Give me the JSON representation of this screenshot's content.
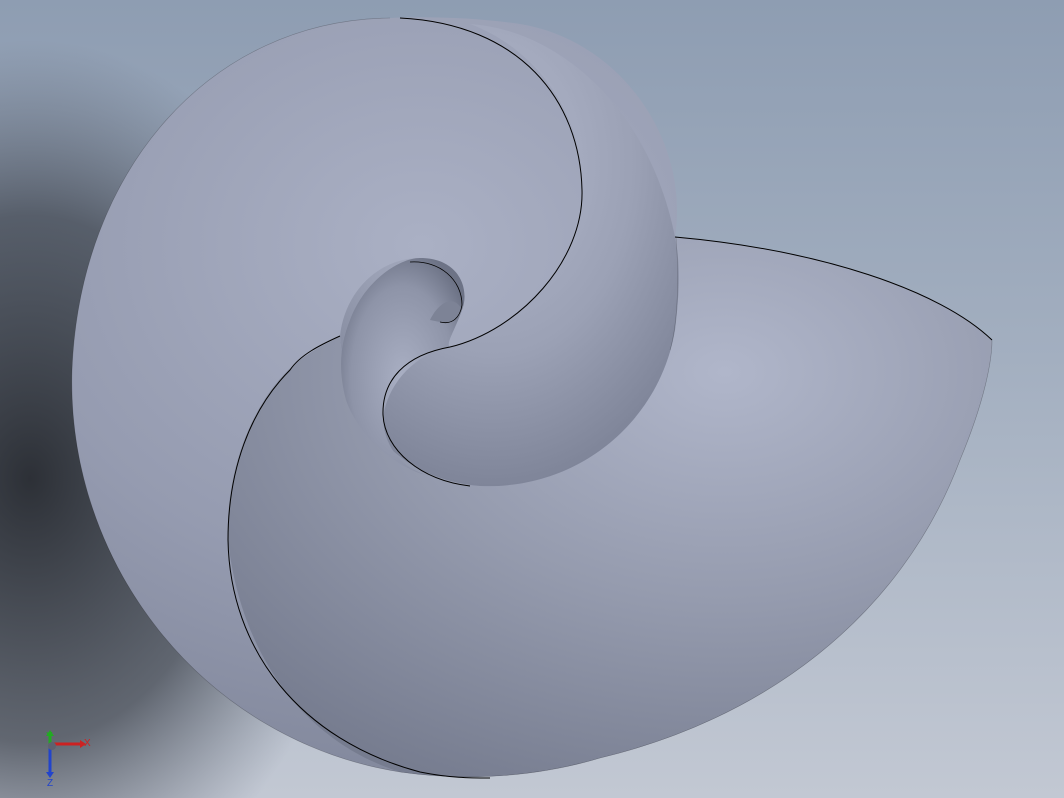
{
  "viewport": {
    "background_top": "#8e9db2",
    "background_bottom": "#c2c8d3",
    "model": {
      "name": "nautilus-shell",
      "color": "#9ea3b6",
      "edge_color": "#000000"
    }
  },
  "triad": {
    "x_label": "X",
    "y_label": "Y",
    "z_label": "Z",
    "x_color": "#cc2222",
    "y_color": "#22aa22",
    "z_color": "#2244cc"
  }
}
